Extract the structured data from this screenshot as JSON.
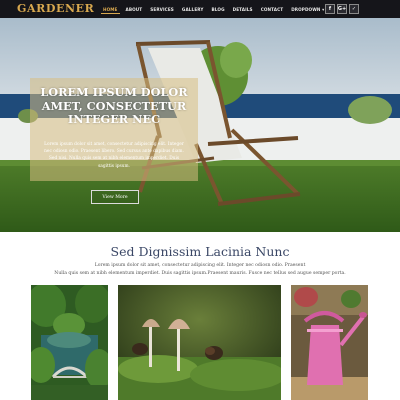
{
  "brand": {
    "logo": "GARDENER"
  },
  "nav": {
    "items": [
      {
        "label": "HOME",
        "active": true
      },
      {
        "label": "ABOUT",
        "active": false
      },
      {
        "label": "SERVICES",
        "active": false
      },
      {
        "label": "GALLERY",
        "active": false
      },
      {
        "label": "BLOG",
        "active": false
      },
      {
        "label": "DETAILS",
        "active": false
      },
      {
        "label": "CONTACT",
        "active": false
      },
      {
        "label": "DROPDOWN ▾",
        "active": false
      }
    ],
    "social": [
      {
        "label": "f",
        "icon": "facebook-icon"
      },
      {
        "label": "G+",
        "icon": "google-plus-icon"
      },
      {
        "label": "✓",
        "icon": "twitter-icon"
      }
    ]
  },
  "hero": {
    "title_lines": [
      "LOREM IPSUM DOLOR",
      "AMET, CONSECTETUR",
      "INTEGER NEC"
    ],
    "text_lines": [
      "Lorem ipsum dolor sit amet, consectetur adipiscing elit. Integer",
      "nec odiosn odio. Praesent libero. Sed cursus ante dapibus diam.",
      "Sed nisi. Nulla quis sem at nibh elementum imperdiet. Duis",
      "sagittis ipsum."
    ],
    "button_label": "View More"
  },
  "section": {
    "title": "Sed Dignissim Lacinia Nunc",
    "text_lines": [
      "Lorem ipsum dolor sit amet, consectetur adipiscing elit. Integer nec odiosn odio. Praesent",
      "Nulla quis sem at nibh elementum imperdiet. Duis sagittis ipsum.Praesent mauris. Fusce nec tellus sed augue semper porta."
    ]
  },
  "gallery": {
    "images": [
      {
        "icon": "garden-bridge-image"
      },
      {
        "icon": "mushrooms-image"
      },
      {
        "icon": "watering-can-image"
      }
    ]
  },
  "colors": {
    "accent": "#d8a84f",
    "nav_bg": "#15151a",
    "section_title": "#3a4766"
  }
}
